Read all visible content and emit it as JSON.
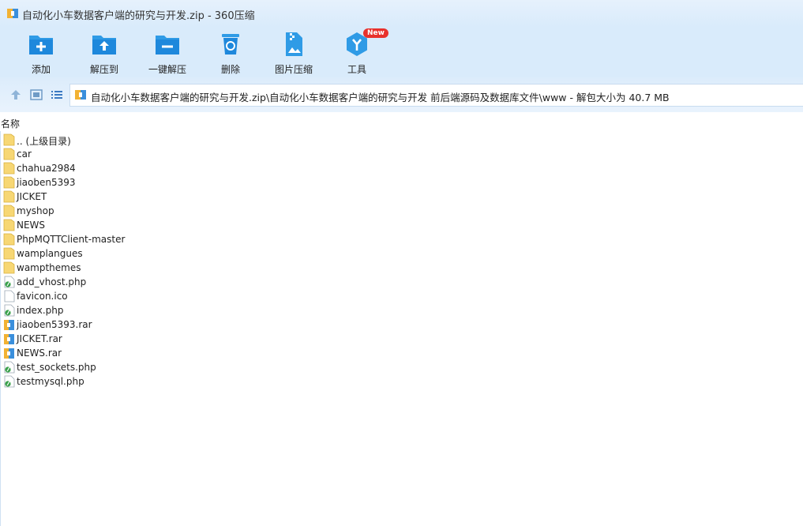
{
  "window": {
    "title": "自动化小车数据客户端的研究与开发.zip - 360压缩"
  },
  "toolbar": {
    "items": [
      {
        "label": "添加",
        "icon": "add-folder-icon"
      },
      {
        "label": "解压到",
        "icon": "extract-to-icon"
      },
      {
        "label": "一键解压",
        "icon": "one-click-extract-icon"
      },
      {
        "label": "删除",
        "icon": "recycle-delete-icon"
      },
      {
        "label": "图片压缩",
        "icon": "image-compress-icon"
      },
      {
        "label": "工具",
        "icon": "tools-icon",
        "badge": "New"
      }
    ]
  },
  "address": {
    "path": "自动化小车数据客户端的研究与开发.zip\\自动化小车数据客户端的研究与开发 前后端源码及数据库文件\\www - 解包大小为 40.7 MB"
  },
  "list": {
    "column_header": "名称",
    "files": [
      {
        "name": ".. (上级目录)",
        "type": "folder"
      },
      {
        "name": "car",
        "type": "folder"
      },
      {
        "name": "chahua2984",
        "type": "folder"
      },
      {
        "name": "jiaoben5393",
        "type": "folder"
      },
      {
        "name": "JICKET",
        "type": "folder"
      },
      {
        "name": "myshop",
        "type": "folder"
      },
      {
        "name": "NEWS",
        "type": "folder"
      },
      {
        "name": "PhpMQTTClient-master",
        "type": "folder"
      },
      {
        "name": "wamplangues",
        "type": "folder"
      },
      {
        "name": "wampthemes",
        "type": "folder"
      },
      {
        "name": "add_vhost.php",
        "type": "php"
      },
      {
        "name": "favicon.ico",
        "type": "file"
      },
      {
        "name": "index.php",
        "type": "php"
      },
      {
        "name": "jiaoben5393.rar",
        "type": "rar"
      },
      {
        "name": "JICKET.rar",
        "type": "rar"
      },
      {
        "name": "NEWS.rar",
        "type": "rar"
      },
      {
        "name": "test_sockets.php",
        "type": "php"
      },
      {
        "name": "testmysql.php",
        "type": "php"
      }
    ]
  },
  "colors": {
    "accent": "#2f9be6",
    "toolbar_bg": "#d9ebfb",
    "folder": "#f7d774",
    "badge": "#e8312c"
  }
}
